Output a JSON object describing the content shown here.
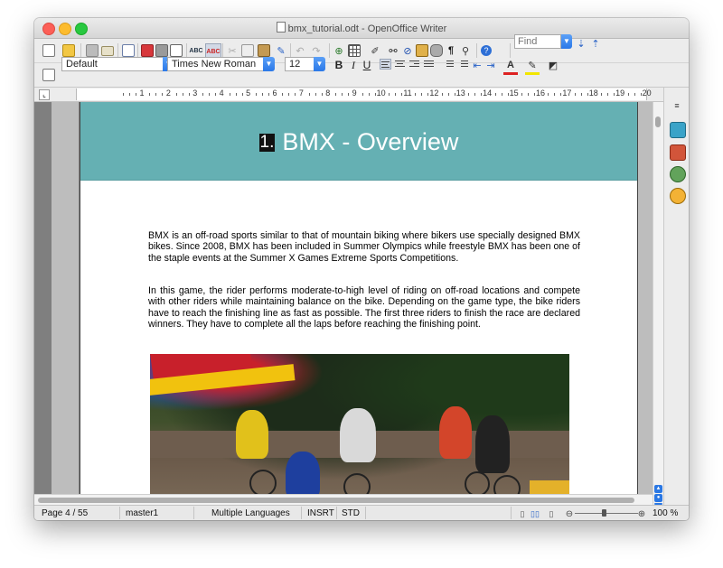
{
  "window": {
    "title": "bmx_tutorial.odt - OpenOffice Writer"
  },
  "toolbar": {
    "find_placeholder": "Find",
    "icons": [
      "new-document-icon",
      "open-folder-icon",
      "save-icon",
      "email-icon",
      "edit-mode-icon",
      "export-pdf-icon",
      "print-icon",
      "print-preview-icon",
      "spellcheck-icon",
      "autospellcheck-icon",
      "cut-icon",
      "copy-icon",
      "paste-icon",
      "clone-format-icon",
      "undo-icon",
      "redo-icon",
      "hyperlink-icon",
      "table-icon",
      "draw-icon",
      "find-replace-icon",
      "navigator-icon",
      "gallery-icon",
      "data-sources-icon",
      "formatting-marks-icon",
      "zoom-icon",
      "help-icon"
    ]
  },
  "formatting": {
    "paragraph_style": "Default",
    "font_name": "Times New Roman",
    "font_size": "12",
    "bold_label": "B",
    "italic_label": "I",
    "underline_label": "U"
  },
  "ruler": {
    "labels": [
      "1",
      "2",
      "3",
      "4",
      "5",
      "6",
      "7",
      "8",
      "9",
      "10",
      "11",
      "12",
      "13",
      "14",
      "15",
      "16",
      "17",
      "18",
      "19",
      "20"
    ]
  },
  "document": {
    "heading_number": "1.",
    "heading_text": "BMX - Overview",
    "paragraphs": [
      "BMX is an off-road sports similar to that of mountain biking where bikers use specially designed BMX bikes. Since 2008, BMX has been included in Summer Olympics while freestyle BMX has been one of the staple events at the Summer X Games Extreme Sports Competitions.",
      "In this game, the rider performs moderate-to-high level of riding on off-road locations and compete with other riders while maintaining balance on the bike. Depending on the game type, the bike riders have to reach the finishing line as fast as possible. The first three riders to finish the race are declared winners. They have to complete all the laps before reaching the finishing point."
    ]
  },
  "statusbar": {
    "page": "Page 4 / 55",
    "page_style": "master1",
    "language": "Multiple Languages",
    "insert_mode": "INSRT",
    "selection_mode": "STD",
    "zoom": "100 %"
  },
  "colors": {
    "header_band": "#65b0b3",
    "accent_blue": "#2a78e8"
  }
}
